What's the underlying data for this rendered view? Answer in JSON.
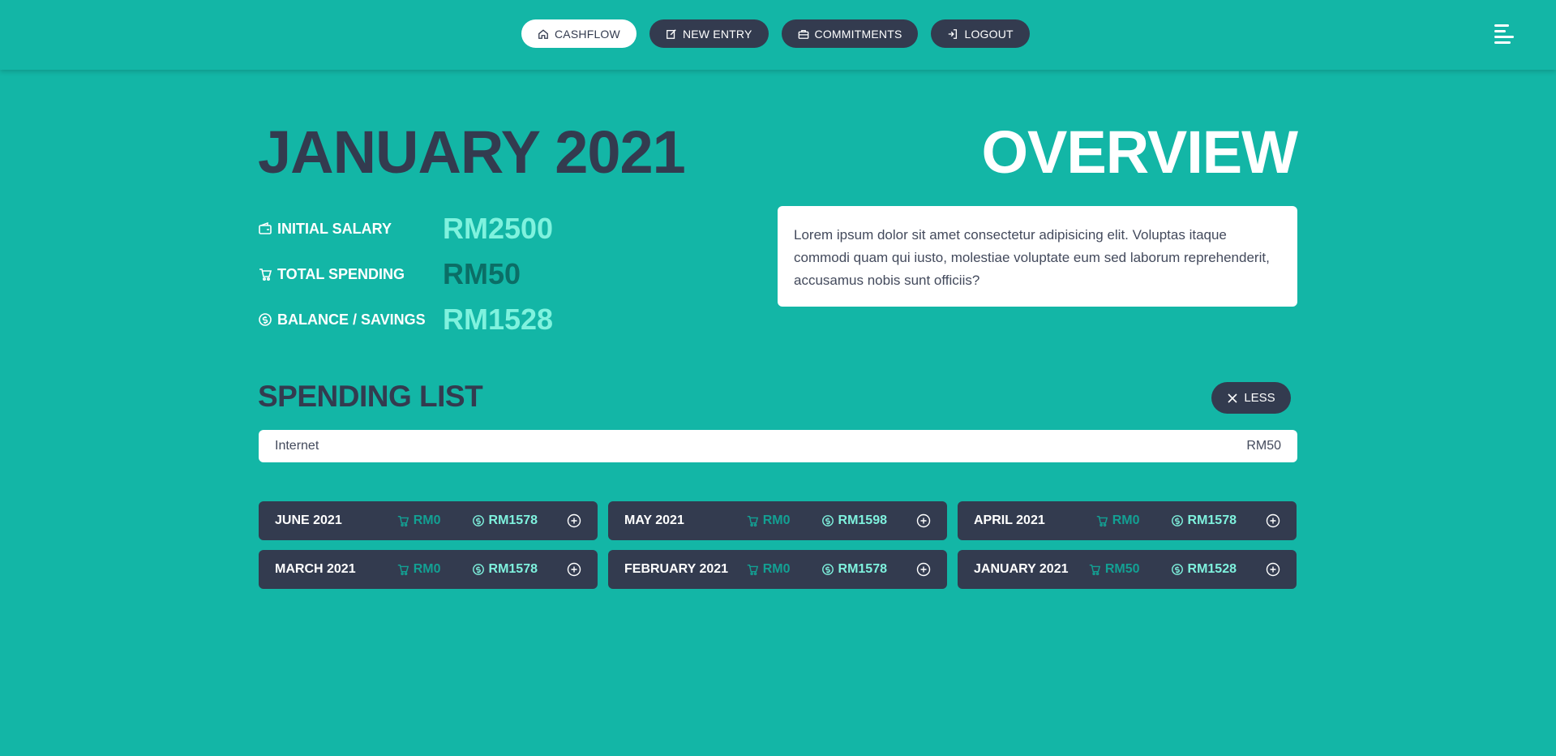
{
  "nav": {
    "items": [
      {
        "label": "CASHFLOW",
        "icon": "home-icon",
        "active": true
      },
      {
        "label": "NEW ENTRY",
        "icon": "edit-icon",
        "active": false
      },
      {
        "label": "COMMITMENTS",
        "icon": "briefcase-icon",
        "active": false
      },
      {
        "label": "LOGOUT",
        "icon": "logout-icon",
        "active": false
      }
    ],
    "menu_icon": "hamburger-menu-icon"
  },
  "summary": {
    "month_title": "JANUARY 2021",
    "overview_title": "OVERVIEW",
    "stats": [
      {
        "label": "INITIAL SALARY",
        "value": "RM2500",
        "icon": "wallet-icon"
      },
      {
        "label": "TOTAL SPENDING",
        "value": "RM50",
        "icon": "cart-icon"
      },
      {
        "label": "BALANCE / SAVINGS",
        "value": "RM1528",
        "icon": "savings-icon"
      }
    ],
    "overview_text": "Lorem ipsum dolor sit amet consectetur adipisicing elit. Voluptas itaque commodi quam qui iusto, molestiae voluptate eum sed laborum reprehenderit, accusamus nobis sunt officiis?"
  },
  "spending_list": {
    "title": "SPENDING LIST",
    "less_label": "LESS",
    "items": [
      {
        "name": "Internet",
        "amount": "RM50"
      }
    ]
  },
  "months": [
    {
      "name": "JUNE 2021",
      "spending": "RM0",
      "balance": "RM1578"
    },
    {
      "name": "MAY 2021",
      "spending": "RM0",
      "balance": "RM1598"
    },
    {
      "name": "APRIL 2021",
      "spending": "RM0",
      "balance": "RM1578"
    },
    {
      "name": "MARCH 2021",
      "spending": "RM0",
      "balance": "RM1578"
    },
    {
      "name": "FEBRUARY 2021",
      "spending": "RM0",
      "balance": "RM1578"
    },
    {
      "name": "JANUARY 2021",
      "spending": "RM50",
      "balance": "RM1528"
    }
  ],
  "colors": {
    "background": "#13b6a6",
    "dark": "#333b4f",
    "accent_light": "#7ff2de",
    "accent_dark": "#0b6e66"
  }
}
